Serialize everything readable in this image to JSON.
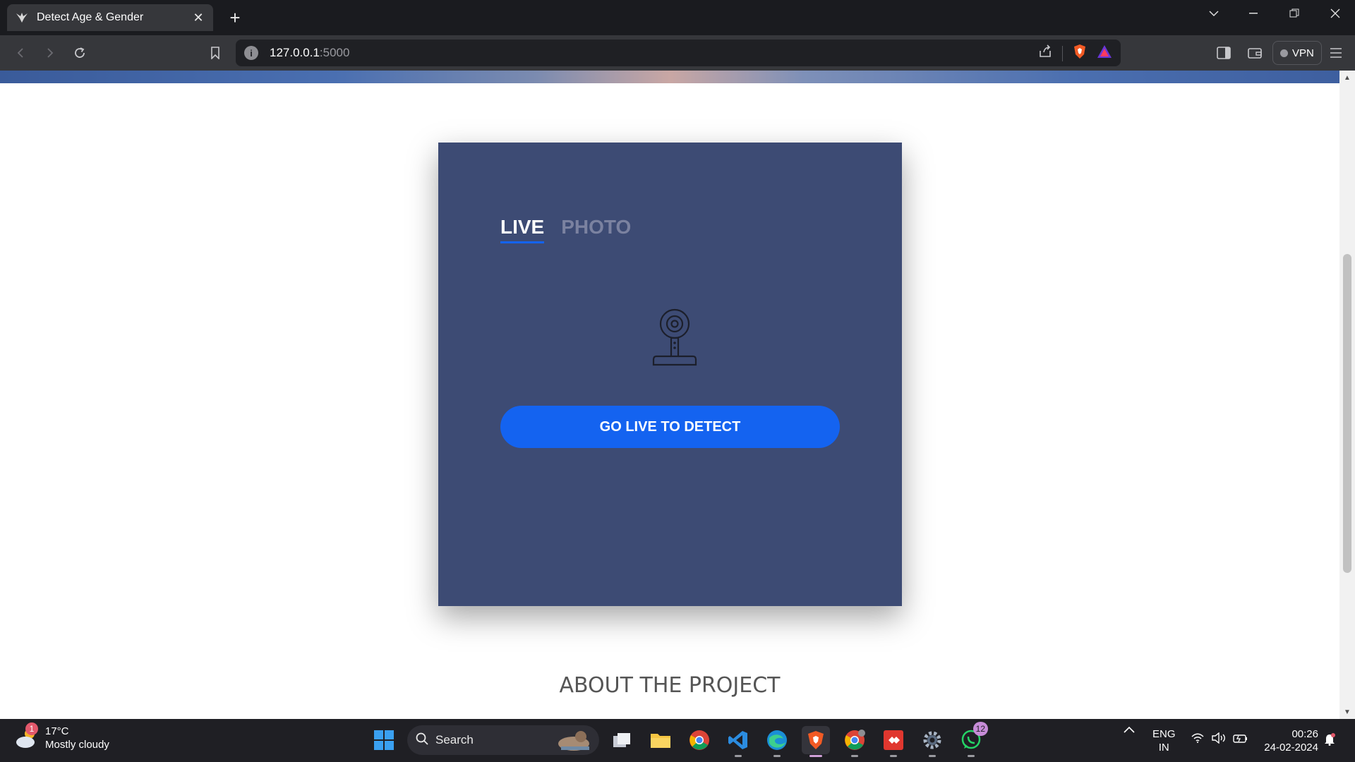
{
  "browser": {
    "tab_title": "Detect Age & Gender",
    "url_host": "127.0.0.1",
    "url_port": ":5000",
    "vpn_label": "VPN"
  },
  "card": {
    "tab_live": "LIVE",
    "tab_photo": "PHOTO",
    "button_label": "GO LIVE TO DETECT"
  },
  "about": {
    "title": "ABOUT THE PROJECT"
  },
  "taskbar": {
    "weather_badge": "1",
    "temperature": "17°C",
    "condition": "Mostly cloudy",
    "search_label": "Search",
    "whatsapp_badge": "12",
    "lang_top": "ENG",
    "lang_bottom": "IN",
    "time": "00:26",
    "date": "24-02-2024"
  },
  "colors": {
    "card_bg": "#3d4b74",
    "accent_blue": "#1463f0",
    "tab_inactive": "#7b82a0"
  }
}
